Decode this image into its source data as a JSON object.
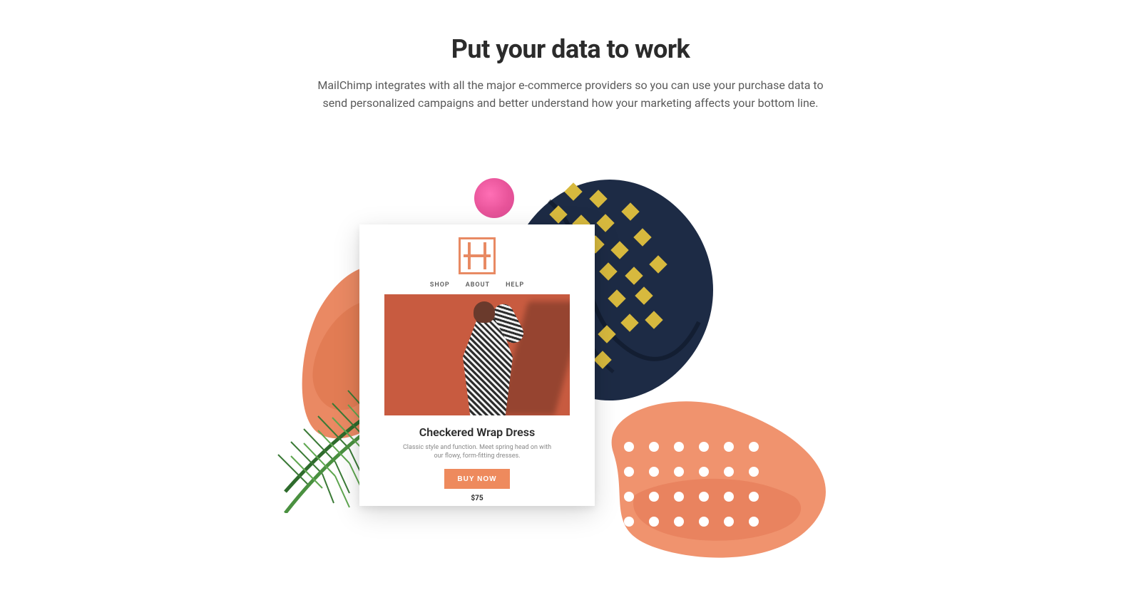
{
  "header": {
    "headline": "Put your data to work",
    "subhead": "MailChimp integrates with all the major e-commerce providers so you can use your purchase data to send personalized campaigns and better understand how your marketing affects your bottom line."
  },
  "email_card": {
    "nav": {
      "shop": "SHOP",
      "about": "ABOUT",
      "help": "HELP"
    },
    "product_title": "Checkered Wrap Dress",
    "product_desc": "Classic style and function. Meet spring head on with our flowy, form-fitting dresses.",
    "cta_label": "BUY NOW",
    "price": "$75"
  }
}
